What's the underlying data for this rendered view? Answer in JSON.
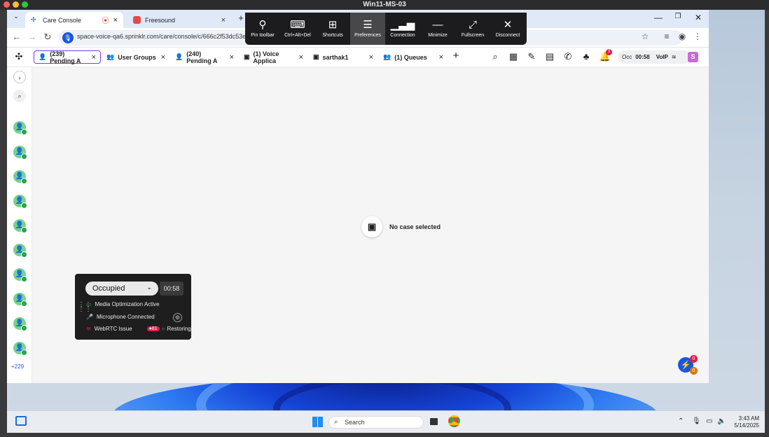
{
  "vm_title": "Win11-MS-03",
  "browser": {
    "tabs": [
      {
        "label": "Care Console",
        "recording": "⦿"
      },
      {
        "label": "Freesound"
      }
    ],
    "new_tab": "+",
    "url": "space-voice-qa6.sprinklr.com/care/console/c/666c2f53dc53e5"
  },
  "rdp_toolbar": {
    "buttons": [
      {
        "label": "Pin toolbar",
        "icon": "pin-icon"
      },
      {
        "label": "Ctrl+Alt+Del",
        "icon": "ctrl-alt-del-icon"
      },
      {
        "label": "Shortcuts",
        "icon": "shortcuts-icon"
      },
      {
        "label": "Preferences",
        "icon": "preferences-icon",
        "active": true
      },
      {
        "label": "Connection",
        "icon": "signal-icon"
      },
      {
        "label": "Minimize",
        "icon": "minimize-icon"
      },
      {
        "label": "Fullscreen",
        "icon": "fullscreen-icon"
      },
      {
        "label": "Disconnect",
        "icon": "disconnect-icon"
      }
    ]
  },
  "app_tabs": [
    {
      "label": "(239) Pending A",
      "icon": "user-icon"
    },
    {
      "label": "User Groups",
      "icon": "group-icon"
    },
    {
      "label": "(240) Pending A",
      "icon": "user-icon"
    },
    {
      "label": "(1) Voice Applica",
      "icon": "book-icon"
    },
    {
      "label": "sarthak1",
      "icon": "book-icon"
    },
    {
      "label": "(1) Queues",
      "icon": "group-icon"
    }
  ],
  "app_toolbar": {
    "notification_count": "3",
    "status_short": "Occ",
    "timer": "00:58",
    "voip": "VoIP",
    "avatar": "S"
  },
  "sidebar": {
    "more_count": "+229"
  },
  "main": {
    "empty_text": "No case selected"
  },
  "pulse_badges": {
    "top": "0",
    "bottom": "0"
  },
  "voice_widget": {
    "status": "Occupied",
    "timer": "00:58",
    "media": "Media Optimization Active",
    "mic": "Microphone Connected",
    "webrtc": "WebRTC Issue",
    "issue_count": "81",
    "restoring": "Restoring"
  },
  "taskbar": {
    "search_placeholder": "Search",
    "time": "3:43 AM",
    "date": "5/14/2025"
  }
}
